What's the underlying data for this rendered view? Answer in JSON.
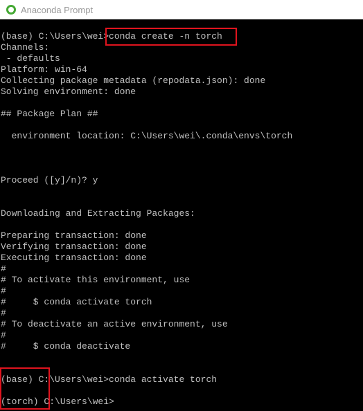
{
  "window": {
    "title": "Anaconda Prompt",
    "app_icon": "anaconda-ring-icon"
  },
  "colors": {
    "background": "#000000",
    "text": "#c0c0c0",
    "highlight": "#e0141e"
  },
  "console": {
    "lines": [
      "(base) C:\\Users\\wei>conda create -n torch",
      "Channels:",
      " - defaults",
      "Platform: win-64",
      "Collecting package metadata (repodata.json): done",
      "Solving environment: done",
      "",
      "## Package Plan ##",
      "",
      "  environment location: C:\\Users\\wei\\.conda\\envs\\torch",
      "",
      "",
      "",
      "Proceed ([y]/n)? y",
      "",
      "",
      "Downloading and Extracting Packages:",
      "",
      "Preparing transaction: done",
      "Verifying transaction: done",
      "Executing transaction: done",
      "#",
      "# To activate this environment, use",
      "#",
      "#     $ conda activate torch",
      "#",
      "# To deactivate an active environment, use",
      "#",
      "#     $ conda deactivate",
      "",
      "",
      "(base) C:\\Users\\wei>conda activate torch",
      "",
      "(torch) C:\\Users\\wei>"
    ]
  }
}
